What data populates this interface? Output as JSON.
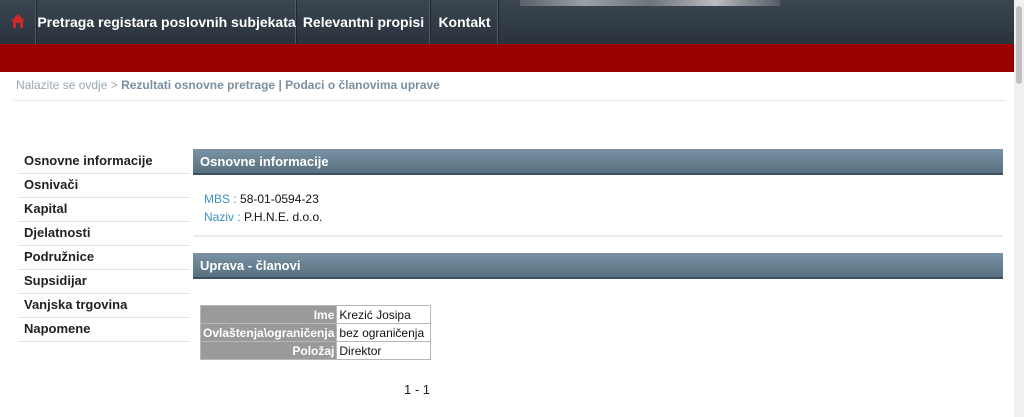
{
  "nav": {
    "home_icon": "home-icon",
    "items": [
      "Pretraga registara poslovnih subjekata",
      "Relevantni propisi",
      "Kontakt"
    ]
  },
  "colors": {
    "accent_red": "#990000",
    "header_dark": "#2f3942",
    "panel_blue": "#6a8496",
    "label_blue": "#3a93c0"
  },
  "breadcrumb": {
    "prefix": "Nalazite se ovdje >",
    "path": "Rezultati osnovne pretrage | Podaci o članovima uprave"
  },
  "sidebar": {
    "items": [
      "Osnovne informacije",
      "Osnivači",
      "Kapital",
      "Djelatnosti",
      "Podružnice",
      "Supsidijar",
      "Vanjska trgovina",
      "Napomene"
    ]
  },
  "basic_info": {
    "title": "Osnovne informacije",
    "mbs_label": "MBS :",
    "mbs_value": "58-01-0594-23",
    "naziv_label": "Naziv :",
    "naziv_value": "P.H.N.E. d.o.o."
  },
  "management": {
    "title": "Uprava - članovi",
    "rows": [
      {
        "key": "Ime",
        "value": "Krezić Josipa"
      },
      {
        "key": "Ovlaštenja\\ograničenja",
        "value": "bez ograničenja"
      },
      {
        "key": "Položaj",
        "value": "Direktor"
      }
    ]
  },
  "pagination": "1 - 1"
}
